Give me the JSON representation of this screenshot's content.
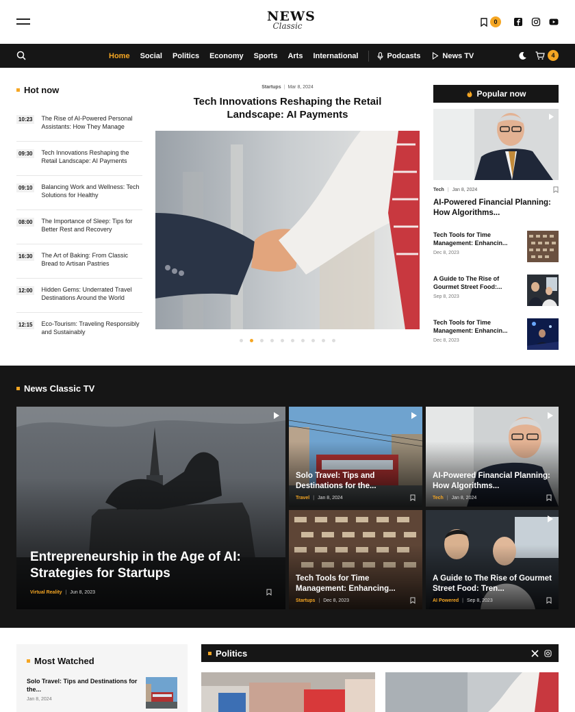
{
  "header": {
    "logo_main": "NEWS",
    "logo_sub": "Classic",
    "bookmark_count": "0",
    "cart_count": "4"
  },
  "nav": {
    "items": [
      "Home",
      "Social",
      "Politics",
      "Economy",
      "Sports",
      "Arts",
      "International"
    ],
    "active": "Home",
    "podcasts": "Podcasts",
    "news_tv": "News TV"
  },
  "hot": {
    "title": "Hot now",
    "items": [
      {
        "time": "10:23",
        "title": "The Rise of AI-Powered Personal Assistants: How They Manage"
      },
      {
        "time": "09:30",
        "title": "Tech Innovations Reshaping the Retail Landscape: AI Payments"
      },
      {
        "time": "09:10",
        "title": "Balancing Work and Wellness: Tech Solutions for Healthy"
      },
      {
        "time": "08:00",
        "title": "The Importance of Sleep: Tips for Better Rest and Recovery"
      },
      {
        "time": "16:30",
        "title": "The Art of Baking: From Classic Bread to Artisan Pastries"
      },
      {
        "time": "12:00",
        "title": "Hidden Gems: Underrated Travel Destinations Around the World"
      },
      {
        "time": "12:15",
        "title": "Eco-Tourism: Traveling Responsibly and Sustainably"
      }
    ]
  },
  "featured": {
    "category": "Startups",
    "date": "Mar 8, 2024",
    "title": "Tech Innovations Reshaping the Retail Landscape: AI Payments",
    "slide_count": 10,
    "active_slide": 2
  },
  "popular": {
    "title": "Popular now",
    "main": {
      "category": "Tech",
      "date": "Jan 8, 2024",
      "title": "AI-Powered Financial Planning: How Algorithms..."
    },
    "items": [
      {
        "title": "Tech Tools for Time Management: Enhancin...",
        "date": "Dec 8, 2023"
      },
      {
        "title": "A Guide to The Rise of Gourmet Street Food:...",
        "date": "Sep 8, 2023"
      },
      {
        "title": "Tech Tools for Time Management: Enhancin...",
        "date": "Dec 8, 2023"
      }
    ]
  },
  "tv": {
    "title": "News Classic TV",
    "big": {
      "title": "Entrepreneurship in the Age of AI: Strategies for Startups",
      "category": "Virtual Reality",
      "date": "Jun 8, 2023"
    },
    "cards": [
      {
        "title": "Solo Travel: Tips and Destinations for the...",
        "category": "Travel",
        "date": "Jan 8, 2024"
      },
      {
        "title": "AI-Powered Financial Planning: How Algorithms...",
        "category": "Tech",
        "date": "Jan 8, 2024"
      },
      {
        "title": "Tech Tools for Time Management: Enhancing...",
        "category": "Startups",
        "date": "Dec 8, 2023"
      },
      {
        "title": "A Guide to The Rise of Gourmet Street Food: Tren...",
        "category": "AI Powered",
        "date": "Sep 8, 2023"
      }
    ]
  },
  "most_watched": {
    "title": "Most Watched",
    "item": {
      "title": "Solo Travel: Tips and Destinations for the...",
      "date": "Jan 8, 2024"
    }
  },
  "politics": {
    "title": "Politics"
  },
  "colors": {
    "accent": "#f5a623",
    "dark": "#161616"
  }
}
